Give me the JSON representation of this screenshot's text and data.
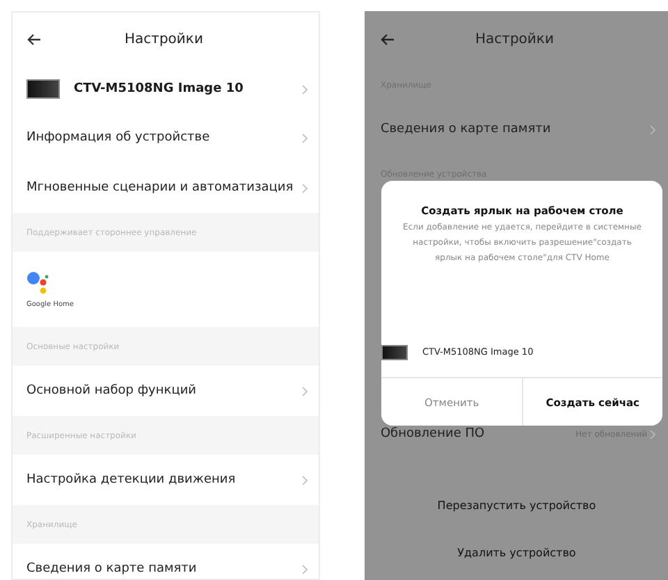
{
  "left_screen": {
    "title": "Настройки",
    "device": {
      "name": "CTV-M5108NG Image 10"
    },
    "items": [
      {
        "kind": "row",
        "label": "Информация об устройстве"
      },
      {
        "kind": "row",
        "label": "Мгновенные сценарии и автоматизация"
      },
      {
        "kind": "section",
        "label": "Поддерживает стороннее управление"
      },
      {
        "kind": "service",
        "label": "Google Home"
      },
      {
        "kind": "section",
        "label": "Основные настройки"
      },
      {
        "kind": "row",
        "label": "Основной набор функций"
      },
      {
        "kind": "section",
        "label": "Расширенные настройки"
      },
      {
        "kind": "row",
        "label": "Настройка детекции движения"
      },
      {
        "kind": "section",
        "label": "Хранилище"
      },
      {
        "kind": "row",
        "label": "Сведения о карте памяти"
      }
    ]
  },
  "right_screen": {
    "title": "Настройки",
    "top_items": [
      {
        "kind": "section",
        "label": "Хранилище"
      },
      {
        "kind": "row",
        "label": "Сведения о карте памяти"
      },
      {
        "kind": "section",
        "label": "Обновление устройства"
      }
    ],
    "update_row": {
      "label": "Обновление ПО",
      "value": "Нет обновлений"
    },
    "actions": [
      "Перезапустить устройство",
      "Удалить устройство"
    ],
    "dialog": {
      "title": "Создать ярлык на рабочем столе",
      "message": "Если добавление не удается, перейдите в системные настройки, чтобы включить разрешение\"создать ярлык на рабочем столе\"для CTV Home",
      "device": "CTV-M5108NG Image 10",
      "cancel": "Отменить",
      "confirm": "Создать сейчас"
    }
  }
}
